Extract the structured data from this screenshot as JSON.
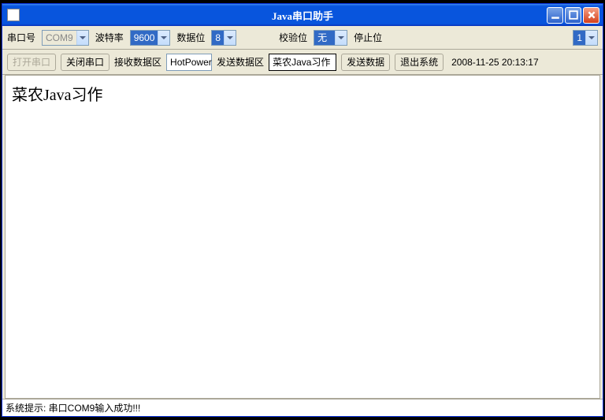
{
  "window": {
    "title": "Java串口助手"
  },
  "row1": {
    "port_label": "串口号",
    "port_value": "COM9",
    "baud_label": "波特率",
    "baud_value": "9600",
    "data_label": "数据位",
    "data_value": "8",
    "parity_label": "校验位",
    "parity_value": "无",
    "stop_label": "停止位",
    "stop_value": "1"
  },
  "row2": {
    "open_btn": "打开串口",
    "close_btn": "关闭串口",
    "recv_label": "接收数据区",
    "recv_value": "HotPower",
    "send_label": "发送数据区",
    "send_value": "菜农Java习作",
    "send_btn": "发送数据",
    "exit_btn": "退出系统",
    "timestamp": "2008-11-25 20:13:17"
  },
  "content": "菜农Java习作",
  "status": {
    "prefix": "系统提示:",
    "msg": " 串口COM9输入成功!!!"
  }
}
